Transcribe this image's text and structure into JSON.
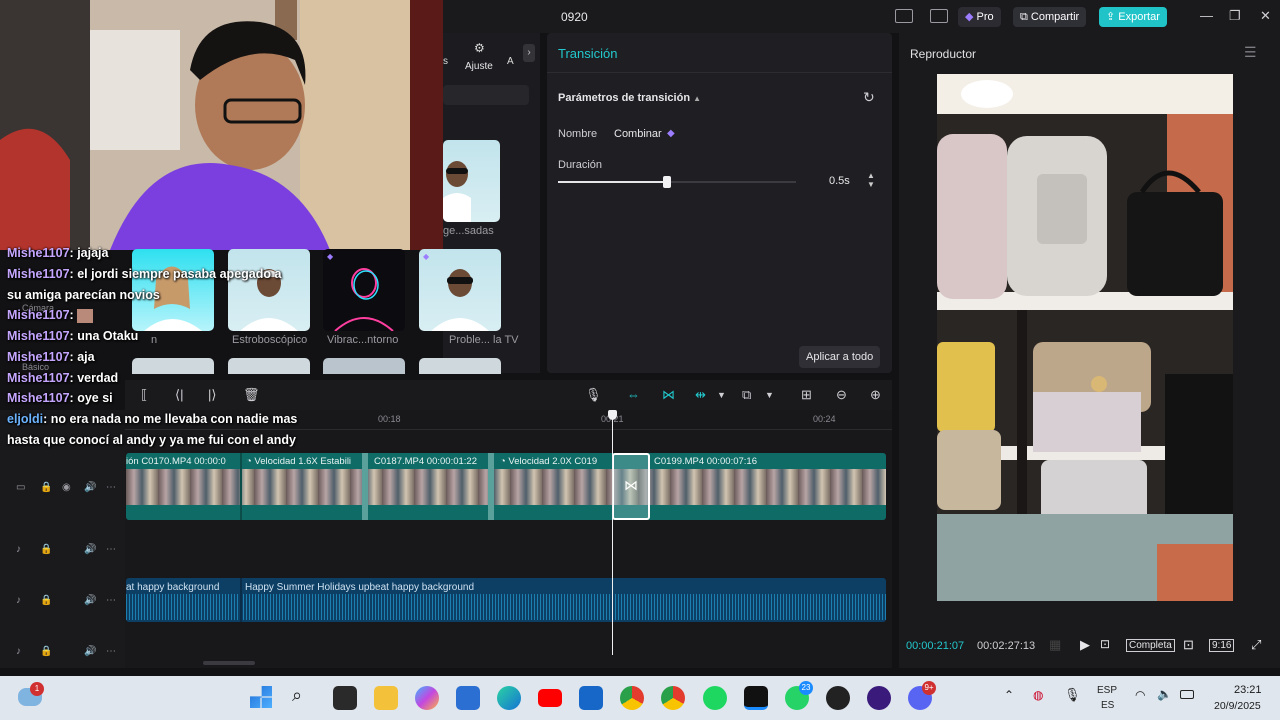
{
  "project": {
    "title": "0920"
  },
  "titlebar": {
    "pro": "Pro",
    "share": "Compartir",
    "export": "Exportar"
  },
  "media": {
    "tab_ajuste": "Ajuste",
    "tab_partial_left": "s",
    "tab_partial_right": "A",
    "thumbs": [
      {
        "label": "ge...sadas"
      },
      {
        "label": "n"
      },
      {
        "label": "Estroboscópico"
      },
      {
        "label": "Vibrac...ntorno"
      },
      {
        "label": "Proble... la TV"
      }
    ],
    "side_labels": {
      "camera": "Cámara",
      "basic": "Básico"
    }
  },
  "transition": {
    "panel_title": "Transición",
    "params_title": "Parámetros de transición",
    "name_label": "Nombre",
    "name_value": "Combinar",
    "duration_label": "Duración",
    "duration_value": "0.5s",
    "duration_fraction": 0.46,
    "apply_all": "Aplicar a todo"
  },
  "player": {
    "title": "Reproductor",
    "time_current": "00:00:21:07",
    "time_total": "00:02:27:13",
    "ratio_full": "Completa",
    "ratio_916": "9:16"
  },
  "timeline": {
    "ruler": [
      "00:18",
      "00:21",
      "00:24"
    ],
    "video_clips": [
      {
        "label": "ión  C0170.MP4  00:00:0"
      },
      {
        "label": "Velocidad 1.6X  Estabili"
      },
      {
        "label": "C0187.MP4  00:00:01:22"
      },
      {
        "label": "Velocidad 2.0X  C019"
      },
      {
        "label": "C0199.MP4  00:00:07:16"
      }
    ],
    "audio_clips": [
      {
        "label": "at happy background"
      },
      {
        "label": "Happy Summer Holidays upbeat happy background"
      }
    ]
  },
  "chat": [
    {
      "user": "Mishe1107",
      "msg": "jajaja"
    },
    {
      "user": "Mishe1107",
      "msg": "el jordi siempre pasaba apegado a"
    },
    {
      "user": "",
      "msg": "su amiga parecían novios"
    },
    {
      "user": "Mishe1107",
      "msg": ""
    },
    {
      "user": "Mishe1107",
      "msg": "una Otaku"
    },
    {
      "user": "Mishe1107",
      "msg": "aja"
    },
    {
      "user": "Mishe1107",
      "msg": "verdad"
    },
    {
      "user": "Mishe1107",
      "msg": "oye si"
    },
    {
      "user": "eljoldi",
      "msg": "no era nada no me llevaba con nadie mas"
    },
    {
      "user": "",
      "msg": "hasta que conocí al andy y ya me fui con el andy"
    }
  ],
  "taskbar": {
    "notif_badge": "1",
    "whatsapp_badge": "23",
    "discord_badge": "9+",
    "lang1": "ESP",
    "lang2": "ES",
    "time": "23:21",
    "date": "20/9/2025"
  },
  "colors": {
    "accent": "#22c8cc",
    "video_track": "#0f6b66",
    "audio_track": "#0d3e63"
  }
}
